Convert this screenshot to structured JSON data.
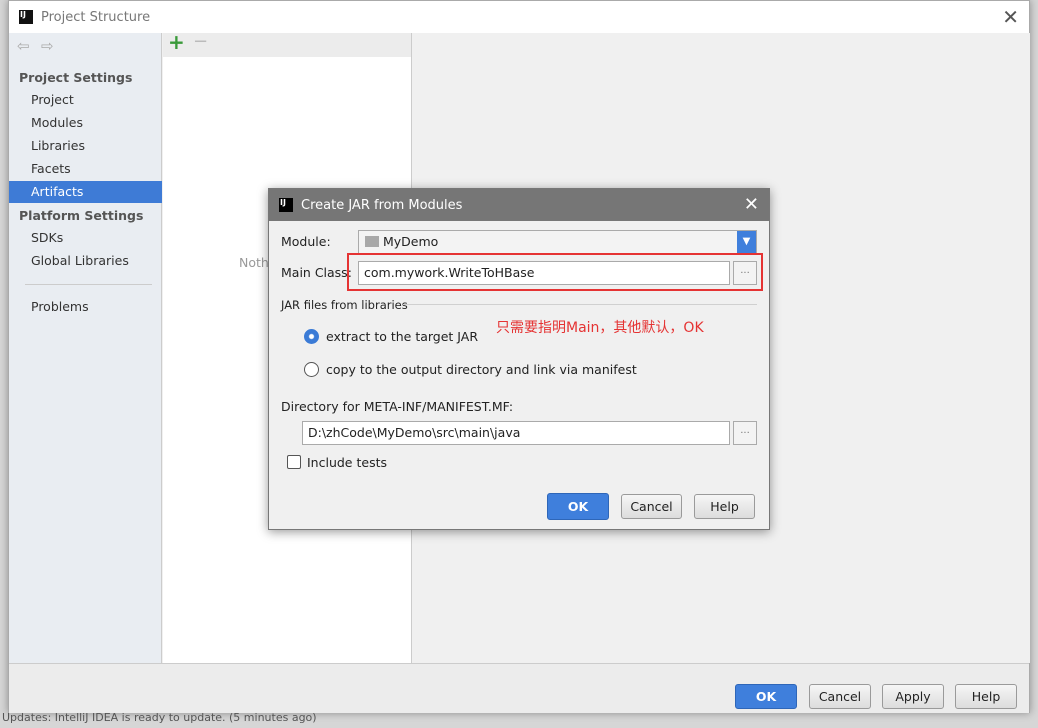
{
  "window": {
    "title": "Project Structure",
    "close": "✕"
  },
  "sidebar": {
    "project_settings": "Project Settings",
    "platform_settings": "Platform Settings",
    "items": [
      {
        "label": "Project"
      },
      {
        "label": "Modules"
      },
      {
        "label": "Libraries"
      },
      {
        "label": "Facets"
      },
      {
        "label": "Artifacts",
        "selected": true
      }
    ],
    "platform_items": [
      {
        "label": "SDKs"
      },
      {
        "label": "Global Libraries"
      }
    ],
    "problems": "Problems"
  },
  "middle": {
    "add": "+",
    "remove": "−"
  },
  "right": {
    "nothing_text": "Noth"
  },
  "bottom_buttons": {
    "ok": "OK",
    "cancel": "Cancel",
    "apply": "Apply",
    "help": "Help"
  },
  "status_bar": {
    "text": "Updates: IntelliJ IDEA is ready to update. (5 minutes ago)"
  },
  "dialog": {
    "title": "Create JAR from Modules",
    "close": "✕",
    "module_label": "Module:",
    "module_value": "MyDemo",
    "main_class_label": "Main Class:",
    "main_class_value": "com.mywork.WriteToHBase",
    "jar_files_label": "JAR files from libraries",
    "radio_extract": "extract to the target JAR",
    "radio_copy": "copy to the output directory and link via manifest",
    "selected_radio": "extract",
    "manifest_label": "Directory for META-INF/MANIFEST.MF:",
    "manifest_value": "D:\\zhCode\\MyDemo\\src\\main\\java",
    "include_tests": "Include tests",
    "include_tests_checked": false,
    "browse": "...",
    "ok": "OK",
    "cancel": "Cancel",
    "help": "Help",
    "annotation": "只需要指明Main，其他默认，OK",
    "annotation_color": "#e53333",
    "accent": "#3f7fdc"
  }
}
